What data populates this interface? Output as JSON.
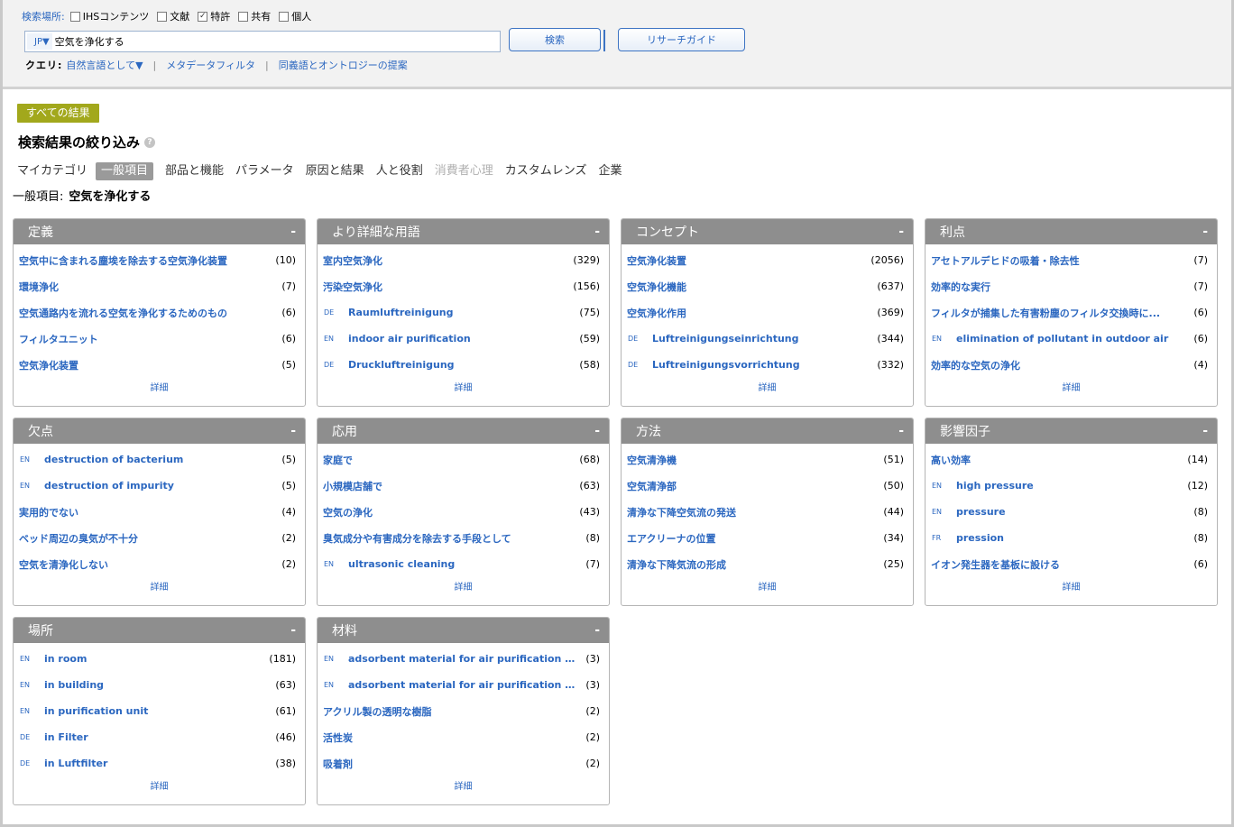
{
  "search": {
    "scope_label": "検索場所:",
    "scopes": [
      {
        "label": "IHSコンテンツ",
        "checked": false
      },
      {
        "label": "文献",
        "checked": false
      },
      {
        "label": "特許",
        "checked": true
      },
      {
        "label": "共有",
        "checked": false
      },
      {
        "label": "個人",
        "checked": false
      }
    ],
    "lang": "JP▼",
    "query": "空気を浄化する",
    "search_button": "検索",
    "guide_button": "リサーチガイド",
    "query_label": "クエリ:",
    "query_mode": "自然言語として▼",
    "metadata_filter": "メタデータフィルタ",
    "synonym_suggest": "同義語とオントロジーの提案"
  },
  "results": {
    "all_results": "すべての結果",
    "refine_title": "検索結果の絞り込み",
    "tabs": [
      {
        "label": "マイカテゴリ",
        "state": "normal"
      },
      {
        "label": "一般項目",
        "state": "active"
      },
      {
        "label": "部品と機能",
        "state": "normal"
      },
      {
        "label": "パラメータ",
        "state": "normal"
      },
      {
        "label": "原因と結果",
        "state": "normal"
      },
      {
        "label": "人と役割",
        "state": "normal"
      },
      {
        "label": "消費者心理",
        "state": "disabled"
      },
      {
        "label": "カスタムレンズ",
        "state": "normal"
      },
      {
        "label": "企業",
        "state": "normal"
      }
    ],
    "crumb_label": "一般項目:",
    "crumb_value": "空気を浄化する"
  },
  "cards": [
    {
      "title": "定義",
      "collapse": "-",
      "detail": "詳細",
      "items": [
        {
          "lang": "",
          "label": "空気中に含まれる塵埃を除去する空気浄化装置",
          "count": "(10)"
        },
        {
          "lang": "",
          "label": "環境浄化",
          "count": "(7)"
        },
        {
          "lang": "",
          "label": "空気通路内を流れる空気を浄化するためのもの",
          "count": "(6)"
        },
        {
          "lang": "",
          "label": "フィルタユニット",
          "count": "(6)"
        },
        {
          "lang": "",
          "label": "空気浄化装置",
          "count": "(5)"
        }
      ]
    },
    {
      "title": "より詳細な用語",
      "collapse": "-",
      "detail": "詳細",
      "items": [
        {
          "lang": "",
          "label": "室内空気浄化",
          "count": "(329)"
        },
        {
          "lang": "",
          "label": "汚染空気浄化",
          "count": "(156)"
        },
        {
          "lang": "DE",
          "label": "Raumluftreinigung",
          "count": "(75)"
        },
        {
          "lang": "EN",
          "label": "indoor air purification",
          "count": "(59)"
        },
        {
          "lang": "DE",
          "label": "Druckluftreinigung",
          "count": "(58)"
        }
      ]
    },
    {
      "title": "コンセプト",
      "collapse": "-",
      "detail": "詳細",
      "items": [
        {
          "lang": "",
          "label": "空気浄化装置",
          "count": "(2056)"
        },
        {
          "lang": "",
          "label": "空気浄化機能",
          "count": "(637)"
        },
        {
          "lang": "",
          "label": "空気浄化作用",
          "count": "(369)"
        },
        {
          "lang": "DE",
          "label": "Luftreinigungseinrichtung",
          "count": "(344)"
        },
        {
          "lang": "DE",
          "label": "Luftreinigungsvorrichtung",
          "count": "(332)"
        }
      ]
    },
    {
      "title": "利点",
      "collapse": "-",
      "detail": "詳細",
      "items": [
        {
          "lang": "",
          "label": "アセトアルデヒドの吸着・除去性",
          "count": "(7)"
        },
        {
          "lang": "",
          "label": "効率的な実行",
          "count": "(7)"
        },
        {
          "lang": "",
          "label": "フィルタが捕集した有害粉塵のフィルタ交換時に...",
          "count": "(6)"
        },
        {
          "lang": "EN",
          "label": "elimination of pollutant in outdoor air",
          "count": "(6)"
        },
        {
          "lang": "",
          "label": "効率的な空気の浄化",
          "count": "(4)"
        }
      ]
    },
    {
      "title": "欠点",
      "collapse": "-",
      "detail": "詳細",
      "items": [
        {
          "lang": "EN",
          "label": "destruction of bacterium",
          "count": "(5)"
        },
        {
          "lang": "EN",
          "label": "destruction of impurity",
          "count": "(5)"
        },
        {
          "lang": "",
          "label": "実用的でない",
          "count": "(4)"
        },
        {
          "lang": "",
          "label": "ベッド周辺の臭気が不十分",
          "count": "(2)"
        },
        {
          "lang": "",
          "label": "空気を清浄化しない",
          "count": "(2)"
        }
      ]
    },
    {
      "title": "応用",
      "collapse": "-",
      "detail": "詳細",
      "items": [
        {
          "lang": "",
          "label": "家庭で",
          "count": "(68)"
        },
        {
          "lang": "",
          "label": "小規模店舗で",
          "count": "(63)"
        },
        {
          "lang": "",
          "label": "空気の浄化",
          "count": "(43)"
        },
        {
          "lang": "",
          "label": "臭気成分や有害成分を除去する手段として",
          "count": "(8)"
        },
        {
          "lang": "EN",
          "label": "ultrasonic cleaning",
          "count": "(7)"
        }
      ]
    },
    {
      "title": "方法",
      "collapse": "-",
      "detail": "詳細",
      "items": [
        {
          "lang": "",
          "label": "空気清浄機",
          "count": "(51)"
        },
        {
          "lang": "",
          "label": "空気清浄部",
          "count": "(50)"
        },
        {
          "lang": "",
          "label": "清浄な下降空気流の発送",
          "count": "(44)"
        },
        {
          "lang": "",
          "label": "エアクリーナの位置",
          "count": "(34)"
        },
        {
          "lang": "",
          "label": "清浄な下降気流の形成",
          "count": "(25)"
        }
      ]
    },
    {
      "title": "影響因子",
      "collapse": "-",
      "detail": "詳細",
      "items": [
        {
          "lang": "",
          "label": "高い効率",
          "count": "(14)"
        },
        {
          "lang": "EN",
          "label": "high pressure",
          "count": "(12)"
        },
        {
          "lang": "EN",
          "label": "pressure",
          "count": "(8)"
        },
        {
          "lang": "FR",
          "label": "pression",
          "count": "(8)"
        },
        {
          "lang": "",
          "label": "イオン発生器を基板に設ける",
          "count": "(6)"
        }
      ]
    },
    {
      "title": "場所",
      "collapse": "-",
      "detail": "詳細",
      "items": [
        {
          "lang": "EN",
          "label": "in room",
          "count": "(181)"
        },
        {
          "lang": "EN",
          "label": "in building",
          "count": "(63)"
        },
        {
          "lang": "EN",
          "label": "in purification unit",
          "count": "(61)"
        },
        {
          "lang": "DE",
          "label": "in Filter",
          "count": "(46)"
        },
        {
          "lang": "DE",
          "label": "in Luftfilter",
          "count": "(38)"
        }
      ]
    },
    {
      "title": "材料",
      "collapse": "-",
      "detail": "詳細",
      "items": [
        {
          "lang": "EN",
          "label": "adsorbent material for air purification or...",
          "count": "(3)"
        },
        {
          "lang": "EN",
          "label": "adsorbent material for air purification or...",
          "count": "(3)"
        },
        {
          "lang": "",
          "label": "アクリル製の透明な樹脂",
          "count": "(2)"
        },
        {
          "lang": "",
          "label": "活性炭",
          "count": "(2)"
        },
        {
          "lang": "",
          "label": "吸着剤",
          "count": "(2)"
        }
      ]
    }
  ]
}
